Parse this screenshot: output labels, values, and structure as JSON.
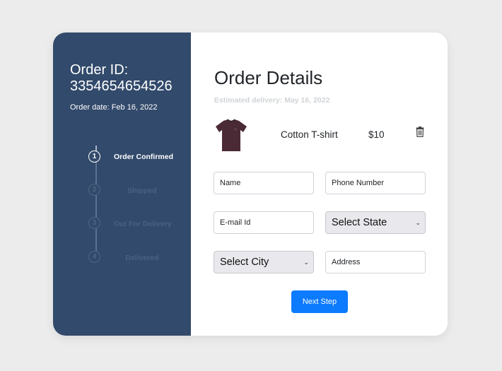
{
  "sidebar": {
    "order_id_label": "Order ID:",
    "order_id_value": "3354654654526",
    "order_date": "Order date: Feb 16, 2022",
    "steps": [
      {
        "number": "1",
        "label": "Order Confirmed",
        "active": true
      },
      {
        "number": "2",
        "label": "Shipped",
        "active": false
      },
      {
        "number": "3",
        "label": "Out For Delivery",
        "active": false
      },
      {
        "number": "4",
        "label": "Delivered",
        "active": false
      }
    ]
  },
  "main": {
    "title": "Order Details",
    "estimated_delivery": "Estimated delivery: May 16, 2022",
    "product": {
      "name": "Cotton T-shirt",
      "price": "$10",
      "image_icon": "tshirt-image",
      "delete_icon": "trash-icon"
    },
    "form": {
      "name_placeholder": "Name",
      "phone_placeholder": "Phone Number",
      "email_placeholder": "E-mail Id",
      "state_select": "Select State",
      "city_select": "Select City",
      "address_placeholder": "Address",
      "submit_label": "Next Step"
    }
  },
  "colors": {
    "sidebar_bg": "#324a6b",
    "accent": "#0d7bfe",
    "page_bg": "#ececec"
  }
}
